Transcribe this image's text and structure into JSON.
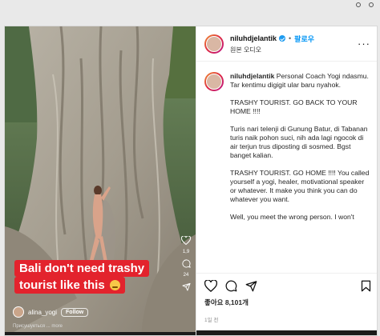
{
  "media": {
    "caption_line1": "Bali don't need trashy",
    "caption_line2": "tourist like this",
    "username": "alina_yogi",
    "follow_label": "Follow",
    "subtext": "Присушуеться ... more",
    "like_count": "1,9",
    "comment_count": "24"
  },
  "header": {
    "username": "niluhdjelantik",
    "follow_label": "팔로우",
    "audio_label": "원본 오디오"
  },
  "post": {
    "username": "niluhdjelantik",
    "intro": "Personal Coach Yogi ndasmu. Tar kentimu digigit ular baru nyahok.",
    "para1": "TRASHY TOURIST. GO BACK TO YOUR HOME !!!!",
    "para2": "Turis nari telenji di Gunung Batur, di Tabanan turis naik pohon suci, nih ada lagi ngocok di air terjun trus diposting di sosmed. Bgst banget kalian.",
    "para3": "TRASHY TOURIST. GO HOME !!!! You called yourself a yogi, healer, motivational speaker or whatever. It make you think you can do whatever you want.",
    "para4": "Well, you meet the wrong person. I won't"
  },
  "footer": {
    "likes": "좋아요 8,101개",
    "time": "1일 전"
  },
  "icons": {
    "like": "heart-icon",
    "comment": "comment-icon",
    "share": "send-icon",
    "save": "bookmark-icon",
    "more": "more-options-icon"
  },
  "colors": {
    "caption_bg": "#e3232d",
    "follow": "#0095f6",
    "verified": "#1d9bf0"
  }
}
